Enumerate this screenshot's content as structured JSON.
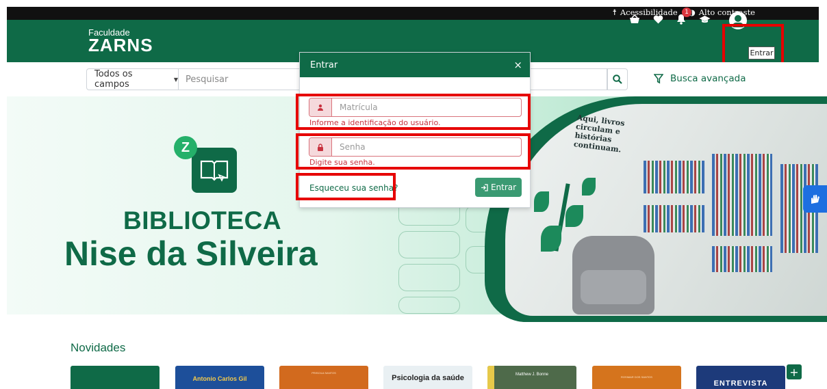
{
  "topbar": {
    "accessibility_icon": "accessibility-icon",
    "accessibility_label": "Acessibilidade",
    "contrast_icon": "contrast-icon",
    "contrast_label": "Alto contraste"
  },
  "header": {
    "logo_small": "Faculdade",
    "logo_big": "ZARNS",
    "icons": [
      "basket-icon",
      "heart-icon",
      "bell-icon",
      "graduation-cap-icon",
      "user-circle-icon"
    ],
    "notification_count": "1",
    "tooltip": "Entrar"
  },
  "search": {
    "field_select": "Todos os campos",
    "placeholder": "Pesquisar",
    "advanced_label": "Busca avançada"
  },
  "banner": {
    "logo_letter": "Z",
    "title_line1": "BIBLIOTECA",
    "title_line2": "Nise da Silveira",
    "wall_text": "Aqui, livros circulam e histórias continuam."
  },
  "modal": {
    "title": "Entrar",
    "close": "×",
    "matricula_placeholder": "Matrícula",
    "matricula_error": "Informe a identificação do usuário.",
    "senha_placeholder": "Senha",
    "senha_error": "Digite sua senha.",
    "forgot_label": "Esqueceu sua senha?",
    "submit_label": "Entrar"
  },
  "novidades": {
    "title": "Novidades",
    "books": [
      {
        "label": "",
        "color": "#0f6a47"
      },
      {
        "label": "Antonio Carlos Gil",
        "color": "#1d4f9a"
      },
      {
        "label": "PRISCILA SANTOS",
        "color": "#d26a1e"
      },
      {
        "label": "Psicologia da saúde",
        "color": "#e9f0f3"
      },
      {
        "label": "Matthew J. Bonne",
        "color": "#4e6a4a"
      },
      {
        "label": "ROSIMAR DOS SANTOS",
        "color": "#d5741d"
      },
      {
        "label": "ENTREVISTA",
        "color": "#1d3a7a"
      }
    ],
    "more": "+"
  },
  "colors": {
    "brand_green": "#0f6a47",
    "error_red": "#c8323f",
    "highlight_red": "#e60000"
  }
}
